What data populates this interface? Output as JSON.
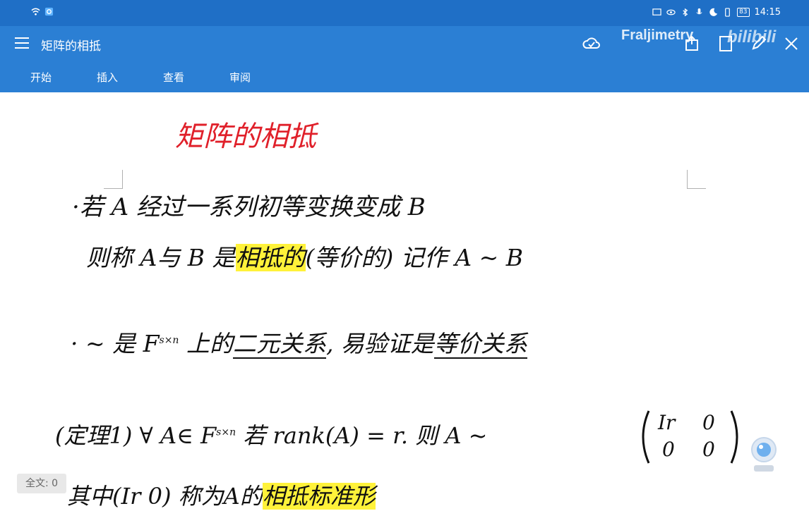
{
  "status_bar": {
    "time": "14:15",
    "battery": "83"
  },
  "title_bar": {
    "document_title": "矩阵的相抵",
    "watermark_text": "Fraljimetry",
    "watermark_logo": "bilibili"
  },
  "tabs": [
    {
      "label": "开始"
    },
    {
      "label": "插入"
    },
    {
      "label": "查看"
    },
    {
      "label": "审阅"
    }
  ],
  "note": {
    "heading": "矩阵的相抵",
    "line1": "·若 A 经过一系列初等变换变成 B",
    "line2_prefix": "则称 A与 B 是",
    "line2_highlight": "相抵的",
    "line2_suffix": "(等价的)    记作 A ~ B",
    "line3_prefix": "· ~ 是 F",
    "line3_sup": "s×n",
    "line3_mid": " 上的",
    "line3_ul1": "二元关系",
    "line3_mid2": ", 易验证是",
    "line3_ul2": "等价关系",
    "line4_prefix": "(定理1)  ∀ A∈ F",
    "line4_sup": "s×n",
    "line4_suffix": "  若 rank(A) = r.  则 A ~",
    "matrix_r0c0": "Ir",
    "matrix_r0c1": "0",
    "matrix_r1c0": "0",
    "matrix_r1c1": "0",
    "line5_prefix": "其中(Ir 0)  称为A的",
    "line5_highlight": "相抵标准形"
  },
  "word_count": "全文: 0",
  "colors": {
    "status_bar": "#1f6fc6",
    "toolbar": "#2b7fd4",
    "heading_ink": "#e0202a",
    "highlight": "#fff23a"
  }
}
